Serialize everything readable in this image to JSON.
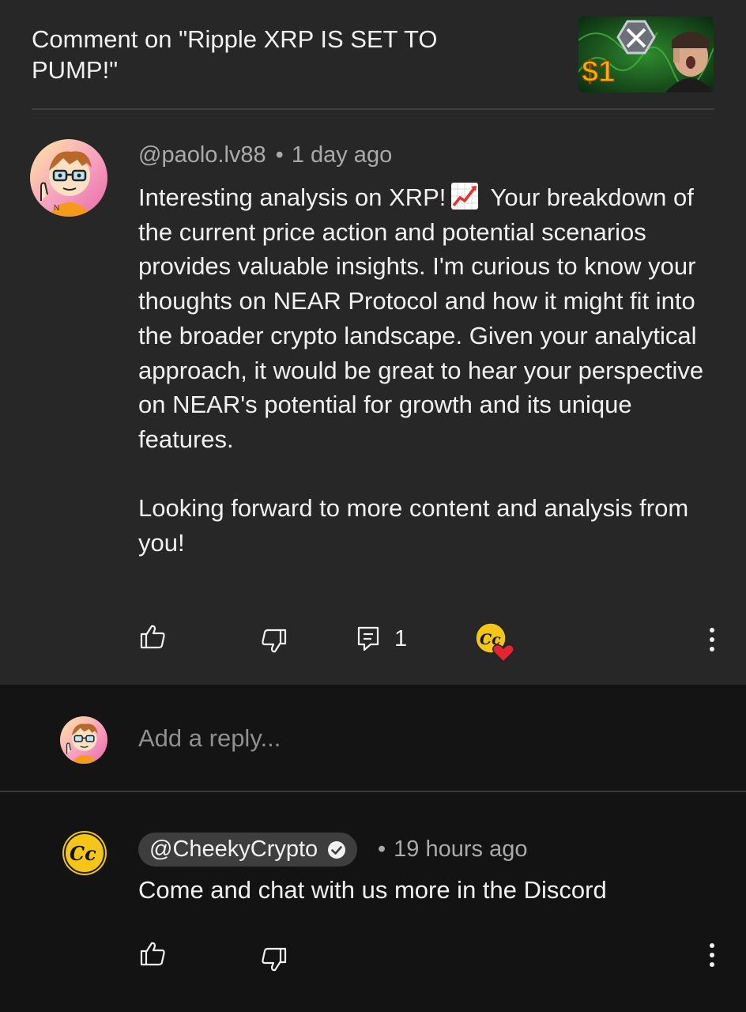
{
  "header": {
    "title": "Comment on \"Ripple XRP IS SET TO PUMP!\"",
    "thumbnail_text": "$1"
  },
  "comment": {
    "author": "@paolo.lv88",
    "separator": "•",
    "time": "1 day ago",
    "body_parts": [
      "Interesting analysis on XRP!",
      "Your breakdown of the current price action and potential scenarios provides valuable insights. I'm curious to know your thoughts on NEAR Protocol and how it might fit into the broader crypto landscape. Given your analytical approach, it would be great to hear your perspective on NEAR's potential for growth and its unique features."
    ],
    "body_closing": "Looking forward to more content and analysis from you!",
    "emoji": "chart-increasing",
    "reply_count": "1",
    "creator_heart": "creator-heart-icon"
  },
  "reply_input": {
    "placeholder": "Add a reply..."
  },
  "reply": {
    "author": "@CheekyCrypto",
    "verified": true,
    "separator": "•",
    "time": "19 hours ago",
    "body": "Come and chat with us more in the Discord",
    "avatar_text": "Cc"
  },
  "colors": {
    "panel": "#272727",
    "background": "#0f0f0f",
    "muted_text": "#aaaaaa",
    "accent_gold": "#f5c518",
    "heart_red": "#e4252f"
  }
}
